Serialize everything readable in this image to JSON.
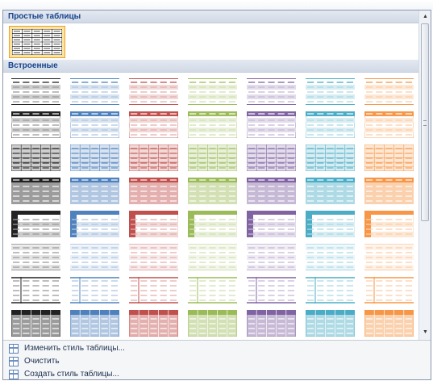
{
  "sections": {
    "simple_title": "Простые таблицы",
    "builtin_title": "Встроенные"
  },
  "style_colors": [
    "#000000",
    "#4f81bd",
    "#c0504d",
    "#9bbb59",
    "#8064a2",
    "#4bacc6",
    "#f79646"
  ],
  "menu": {
    "modify": {
      "label": "Изменить стиль таблицы...",
      "icon": "modify-table-style-icon"
    },
    "clear": {
      "label": "Очистить",
      "icon": "clear-table-style-icon"
    },
    "new": {
      "label": "Создать стиль таблицы...",
      "icon": "new-table-style-icon"
    }
  },
  "scrollbar": {
    "up_icon": "scroll-up-icon",
    "down_icon": "scroll-down-icon"
  }
}
